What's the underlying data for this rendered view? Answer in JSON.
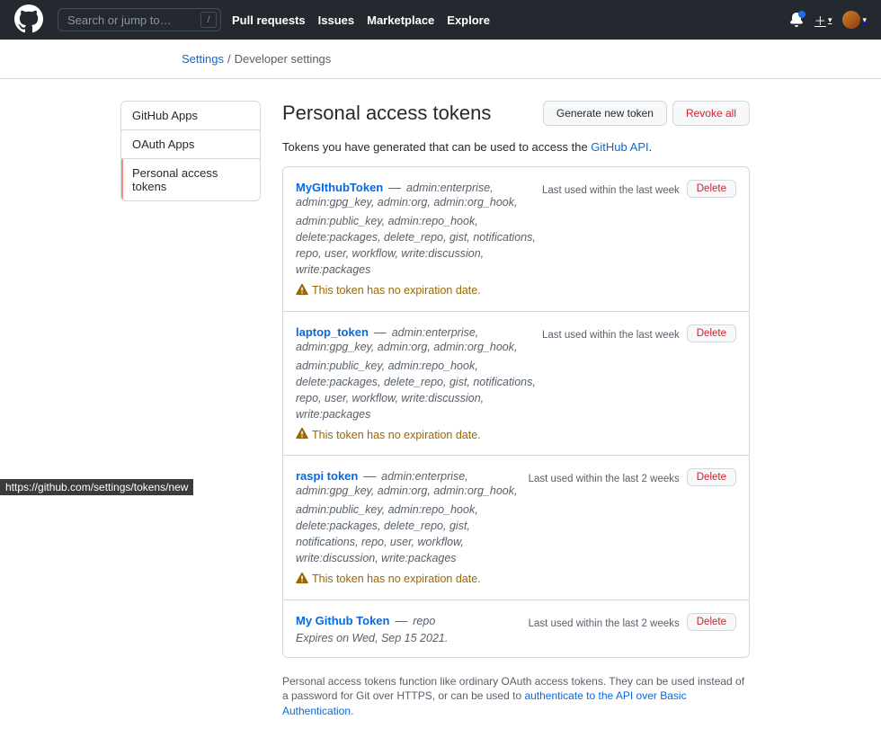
{
  "header": {
    "search_placeholder": "Search or jump to…",
    "nav": [
      "Pull requests",
      "Issues",
      "Marketplace",
      "Explore"
    ]
  },
  "breadcrumb": {
    "parent": "Settings",
    "current": "Developer settings"
  },
  "sidenav": {
    "items": [
      {
        "label": "GitHub Apps",
        "selected": false
      },
      {
        "label": "OAuth Apps",
        "selected": false
      },
      {
        "label": "Personal access tokens",
        "selected": true
      }
    ]
  },
  "page": {
    "title": "Personal access tokens",
    "btn_generate": "Generate new token",
    "btn_revoke_all": "Revoke all",
    "intro_pre": "Tokens you have generated that can be used to access the ",
    "intro_link": "GitHub API",
    "intro_post": ".",
    "footer_pre": "Personal access tokens function like ordinary OAuth access tokens. They can be used instead of a password for Git over HTTPS, or can be used to ",
    "footer_link": "authenticate to the API over Basic Authentication",
    "footer_post": "."
  },
  "tokens": [
    {
      "name": "MyGIthubToken",
      "scopes_head": "admin:enterprise, admin:gpg_key, admin:org, admin:org_hook,",
      "scopes_rest": "admin:public_key, admin:repo_hook, delete:packages, delete_repo, gist, notifications, repo, user, workflow, write:discussion, write:packages",
      "last_used": "Last used within the last week",
      "warning": "This token has no expiration date.",
      "expires": null,
      "delete": "Delete"
    },
    {
      "name": "laptop_token",
      "scopes_head": "admin:enterprise, admin:gpg_key, admin:org, admin:org_hook,",
      "scopes_rest": "admin:public_key, admin:repo_hook, delete:packages, delete_repo, gist, notifications, repo, user, workflow, write:discussion, write:packages",
      "last_used": "Last used within the last week",
      "warning": "This token has no expiration date.",
      "expires": null,
      "delete": "Delete"
    },
    {
      "name": "raspi token",
      "scopes_head": "admin:enterprise, admin:gpg_key, admin:org, admin:org_hook,",
      "scopes_rest": "admin:public_key, admin:repo_hook, delete:packages, delete_repo, gist, notifications, repo, user, workflow, write:discussion, write:packages",
      "last_used": "Last used within the last 2 weeks",
      "warning": "This token has no expiration date.",
      "expires": null,
      "delete": "Delete"
    },
    {
      "name": "My Github Token",
      "scopes_head": "repo",
      "scopes_rest": null,
      "last_used": "Last used within the last 2 weeks",
      "warning": null,
      "expires": "Expires on Wed, Sep 15 2021.",
      "delete": "Delete"
    }
  ],
  "status_url": "https://github.com/settings/tokens/new"
}
